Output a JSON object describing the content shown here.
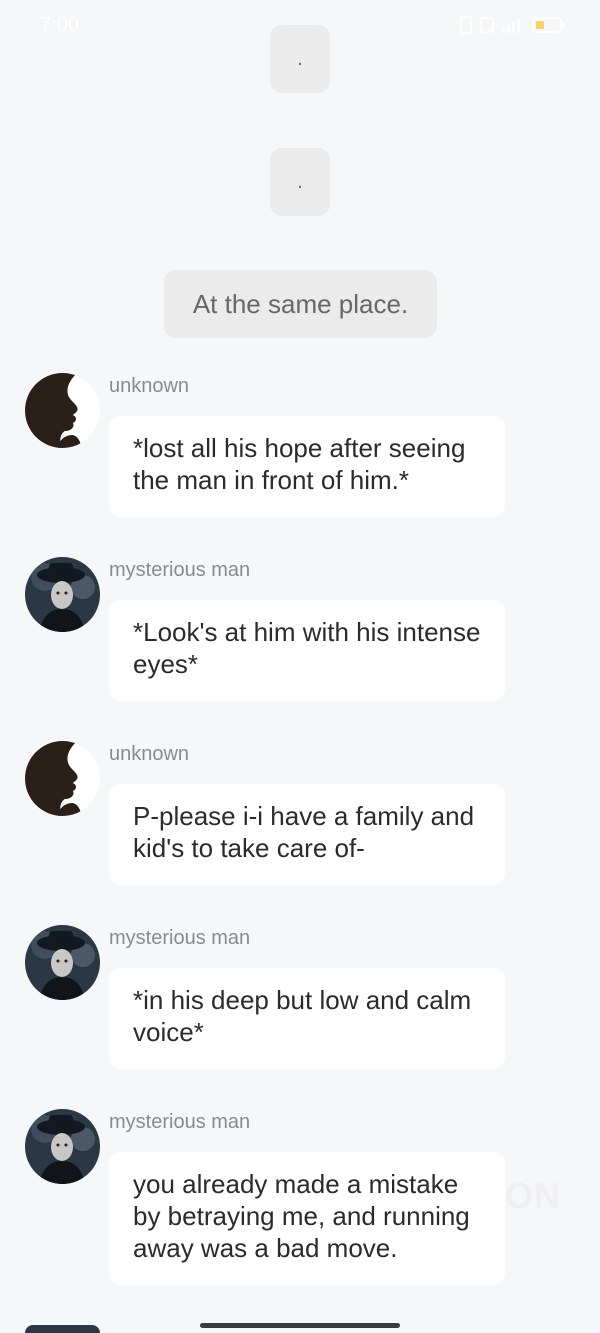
{
  "status_bar": {
    "time": "7:00",
    "icons": [
      "vibrate-icon",
      "alarm-icon",
      "signal-icon",
      "battery-icon"
    ],
    "battery_color": "#f3d36a"
  },
  "narration": [
    {
      "text": "."
    },
    {
      "text": "."
    },
    {
      "text": "At the same place."
    }
  ],
  "messages": [
    {
      "sender": "unknown",
      "avatar": "silhouette-avatar",
      "text": "*lost all his hope after seeing the man in front of him.*"
    },
    {
      "sender": "mysterious man",
      "avatar": "dark-portrait-avatar",
      "text": "*Look's at him with his intense eyes*"
    },
    {
      "sender": "unknown",
      "avatar": "silhouette-avatar",
      "text": "P-please i-i have a family and kid's to take care of-"
    },
    {
      "sender": "mysterious man",
      "avatar": "dark-portrait-avatar",
      "text": "*in his deep but low and calm voice*"
    },
    {
      "sender": "mysterious man",
      "avatar": "dark-portrait-avatar",
      "text": "you already made a mistake by betraying me, and running away was a bad move."
    }
  ],
  "watermark": "ON",
  "colors": {
    "background": "#f6f7f9",
    "system_bubble": "#ebebeb",
    "message_bubble": "#ffffff",
    "sender_name": "#8b8b8b"
  }
}
